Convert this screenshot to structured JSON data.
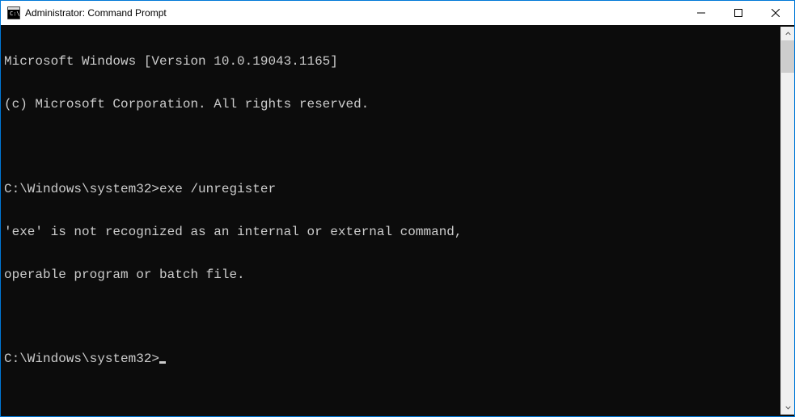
{
  "window": {
    "title": "Administrator: Command Prompt"
  },
  "terminal": {
    "lines": [
      "Microsoft Windows [Version 10.0.19043.1165]",
      "(c) Microsoft Corporation. All rights reserved.",
      "",
      "C:\\Windows\\system32>exe /unregister",
      "'exe' is not recognized as an internal or external command,",
      "operable program or batch file.",
      ""
    ],
    "prompt": "C:\\Windows\\system32>"
  }
}
